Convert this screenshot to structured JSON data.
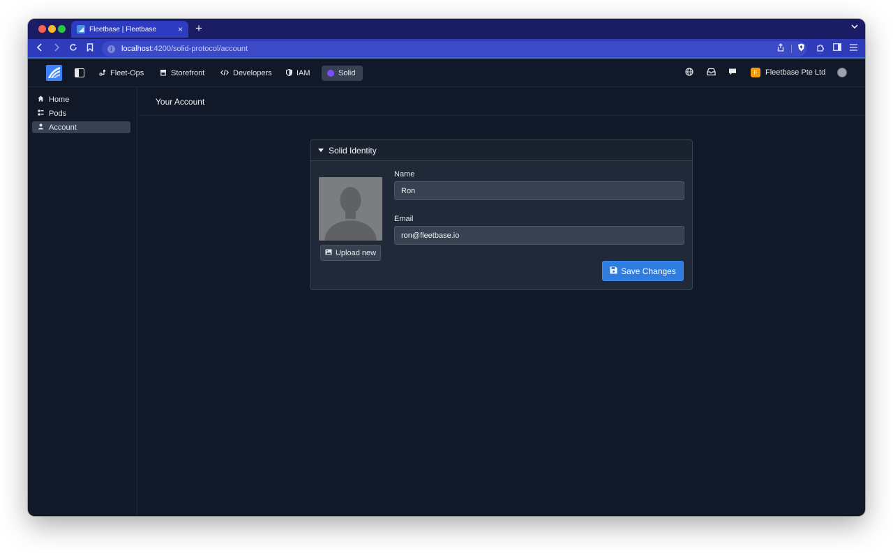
{
  "browser": {
    "tab_title": "Fleetbase | Fleetbase",
    "tab_close": "×",
    "new_tab": "+",
    "url_host": "localhost",
    "url_path": ":4200/solid-protocol/account"
  },
  "header": {
    "nav": [
      {
        "label": "Fleet-Ops",
        "icon": "route-icon"
      },
      {
        "label": "Storefront",
        "icon": "store-icon"
      },
      {
        "label": "Developers",
        "icon": "code-icon"
      },
      {
        "label": "IAM",
        "icon": "shield-icon"
      },
      {
        "label": "Solid",
        "icon": "solid-icon",
        "active": true
      }
    ],
    "org_initial": "F",
    "org_name": "Fleetbase Pte Ltd"
  },
  "sidebar": {
    "items": [
      {
        "label": "Home",
        "icon": "home-icon"
      },
      {
        "label": "Pods",
        "icon": "pods-icon"
      },
      {
        "label": "Account",
        "icon": "user-icon",
        "active": true
      }
    ]
  },
  "main": {
    "page_title": "Your Account",
    "panel_title": "Solid Identity",
    "name_label": "Name",
    "name_value": "Ron",
    "email_label": "Email",
    "email_value": "ron@fleetbase.io",
    "upload_label": "Upload new",
    "save_label": "Save Changes"
  },
  "colors": {
    "background": "#111827",
    "panel": "#1f2937",
    "accent": "#2f7de1",
    "browser_chrome": "#2e3cbb"
  }
}
